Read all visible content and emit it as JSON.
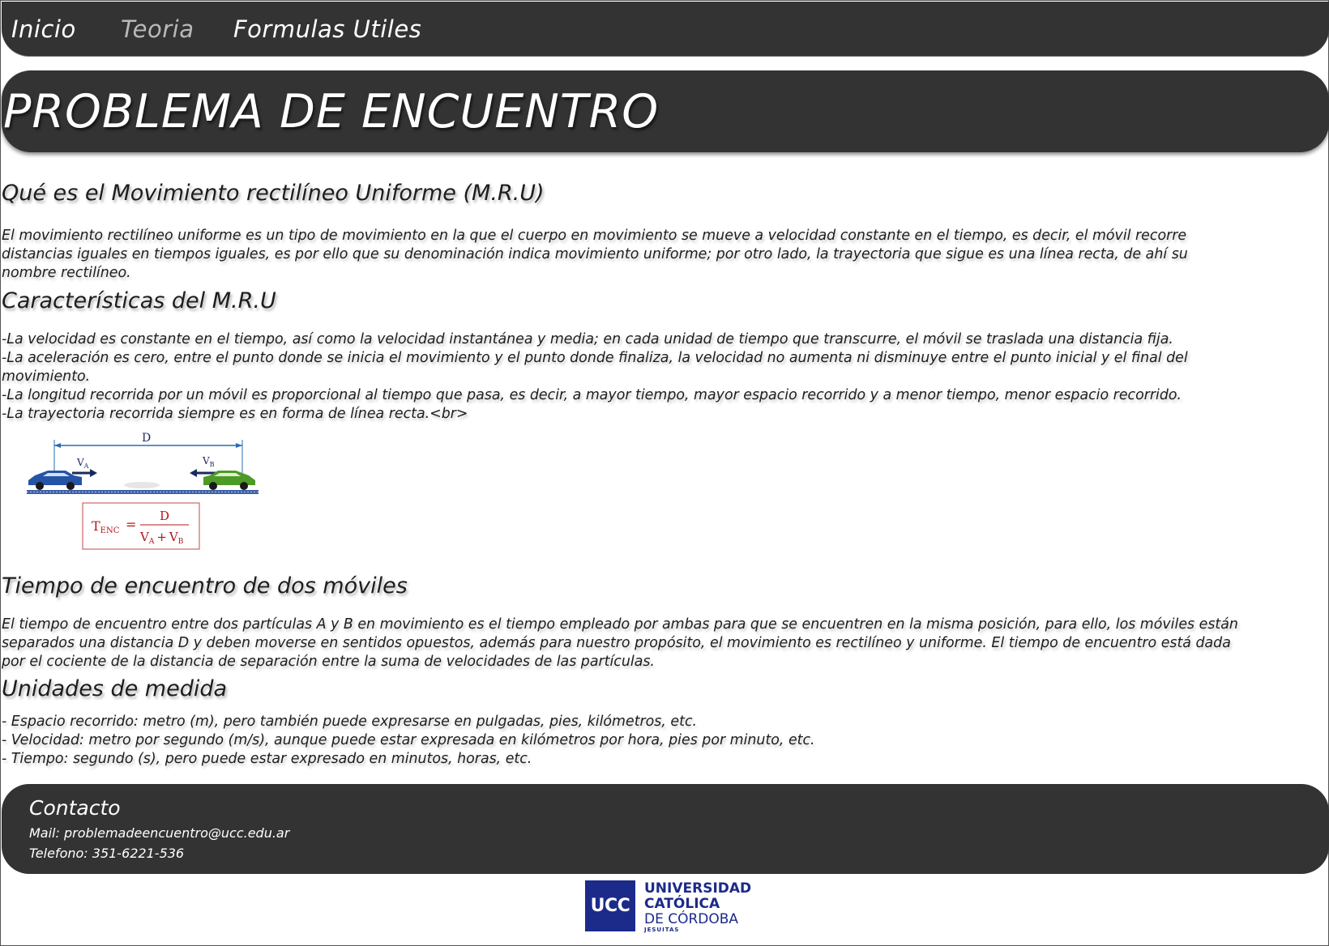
{
  "nav": {
    "items": [
      {
        "label": "Inicio"
      },
      {
        "label": "Teoria"
      },
      {
        "label": "Formulas Utiles"
      }
    ]
  },
  "hero": {
    "title": "PROBLEMA DE ENCUENTRO"
  },
  "sections": {
    "mru": {
      "heading": "Qué es el Movimiento rectilíneo Uniforme (M.R.U)",
      "lines": [
        "El movimiento rectilíneo uniforme es un tipo de movimiento en la que el cuerpo en movimiento se mueve a velocidad constante en el tiempo, es decir, el móvil recorre",
        "distancias iguales en tiempos iguales, es por ello que su denominación indica movimiento uniforme; por otro lado, la trayectoria que sigue es una línea recta, de  ahí su",
        "nombre rectilíneo."
      ]
    },
    "caracteristicas": {
      "heading": "Características del M.R.U",
      "lines": [
        "-La velocidad es constante en el tiempo, así como la velocidad instantánea y media; en cada unidad  de tiempo que transcurre, el móvil se traslada una distancia fija.",
        "-La aceleración es cero, entre el punto donde se inicia el movimiento y el punto donde finaliza, la velocidad no aumenta ni disminuye entre el punto inicial y el final del",
        "movimiento.",
        "-La longitud recorrida por un móvil es proporcional al tiempo que pasa, es decir, a mayor tiempo, mayor espacio recorrido y a menor tiempo, menor espacio recorrido.",
        "-La trayectoria recorrida siempre es en forma de línea recta.<br>"
      ]
    },
    "figure": {
      "distance_label": "D",
      "va_label": "V",
      "va_sub": "A",
      "vb_label": "V",
      "vb_sub": "B",
      "formula_t": "T",
      "formula_t_sub": "ENC",
      "formula_eq": "=",
      "formula_num": "D",
      "formula_den_va": "V",
      "formula_den_va_sub": "A",
      "formula_den_plus": "+",
      "formula_den_vb": "V",
      "formula_den_vb_sub": "B",
      "colors": {
        "car_a": "#2553a6",
        "car_b": "#4e9a28",
        "dimension": "#2a6db0",
        "formula": "#b0161b",
        "arrow": "#1b2a5c"
      }
    },
    "tiempo": {
      "heading": "Tiempo de encuentro de dos móviles",
      "lines": [
        "El tiempo de encuentro entre dos partículas A y B en movimiento es el tiempo empleado por ambas  para que se encuentren en la misma posición, para ello, los móviles están",
        "separados una distancia D y deben moverse en sentidos opuestos, además para nuestro propósito, el movimiento es rectilíneo y uniforme. El tiempo de encuentro está dada",
        "por el cociente de la distancia de separación entre la suma de velocidades de las partículas."
      ]
    },
    "unidades": {
      "heading": "Unidades de medida",
      "lines": [
        " - Espacio recorrido: metro (m), pero también puede expresarse en pulgadas, pies, kilómetros, etc.",
        " - Velocidad: metro por segundo (m/s), aunque puede estar expresada en kilómetros por hora, pies por minuto, etc.",
        " - Tiempo: segundo (s), pero puede estar expresado en minutos, horas, etc."
      ]
    }
  },
  "footer": {
    "title": "Contacto",
    "mail": "Mail: problemadeencuentro@ucc.edu.ar",
    "phone": "Telefono: 351-6221-536"
  },
  "logo": {
    "abbr": "UCC",
    "line1": "UNIVERSIDAD",
    "line2": "CATÓLICA",
    "line3": "DE CÓRDOBA",
    "line4": "JESUITAS",
    "color": "#1c2a8a"
  },
  "colors": {
    "bar_background": "#333333",
    "nav_muted": "#b9b9b9",
    "text": "#1d1d1d"
  }
}
